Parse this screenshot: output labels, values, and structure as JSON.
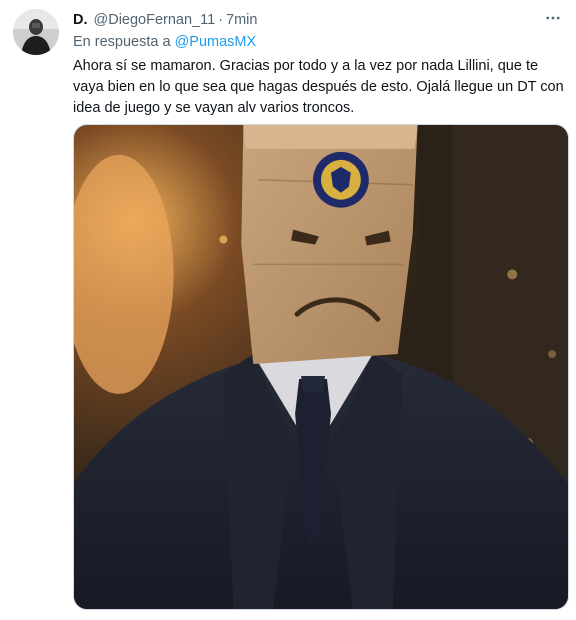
{
  "tweet": {
    "display_name": "D.",
    "handle": "@DiegoFernan_11",
    "separator": "·",
    "time": "7min",
    "reply_prefix": "En respuesta a",
    "reply_mention": "@PumasMX",
    "text": "Ahora sí se mamaron. Gracias por todo y a la vez por nada Lillini, que te vaya bien en lo que sea que hagas después de esto. Ojalá llegue un DT con idea de juego y se vayan alv varios troncos.",
    "more_icon": "more-horizontal-icon"
  },
  "colors": {
    "link": "#1d9bf0",
    "secondary_text": "#536471",
    "primary_text": "#0f1419"
  }
}
